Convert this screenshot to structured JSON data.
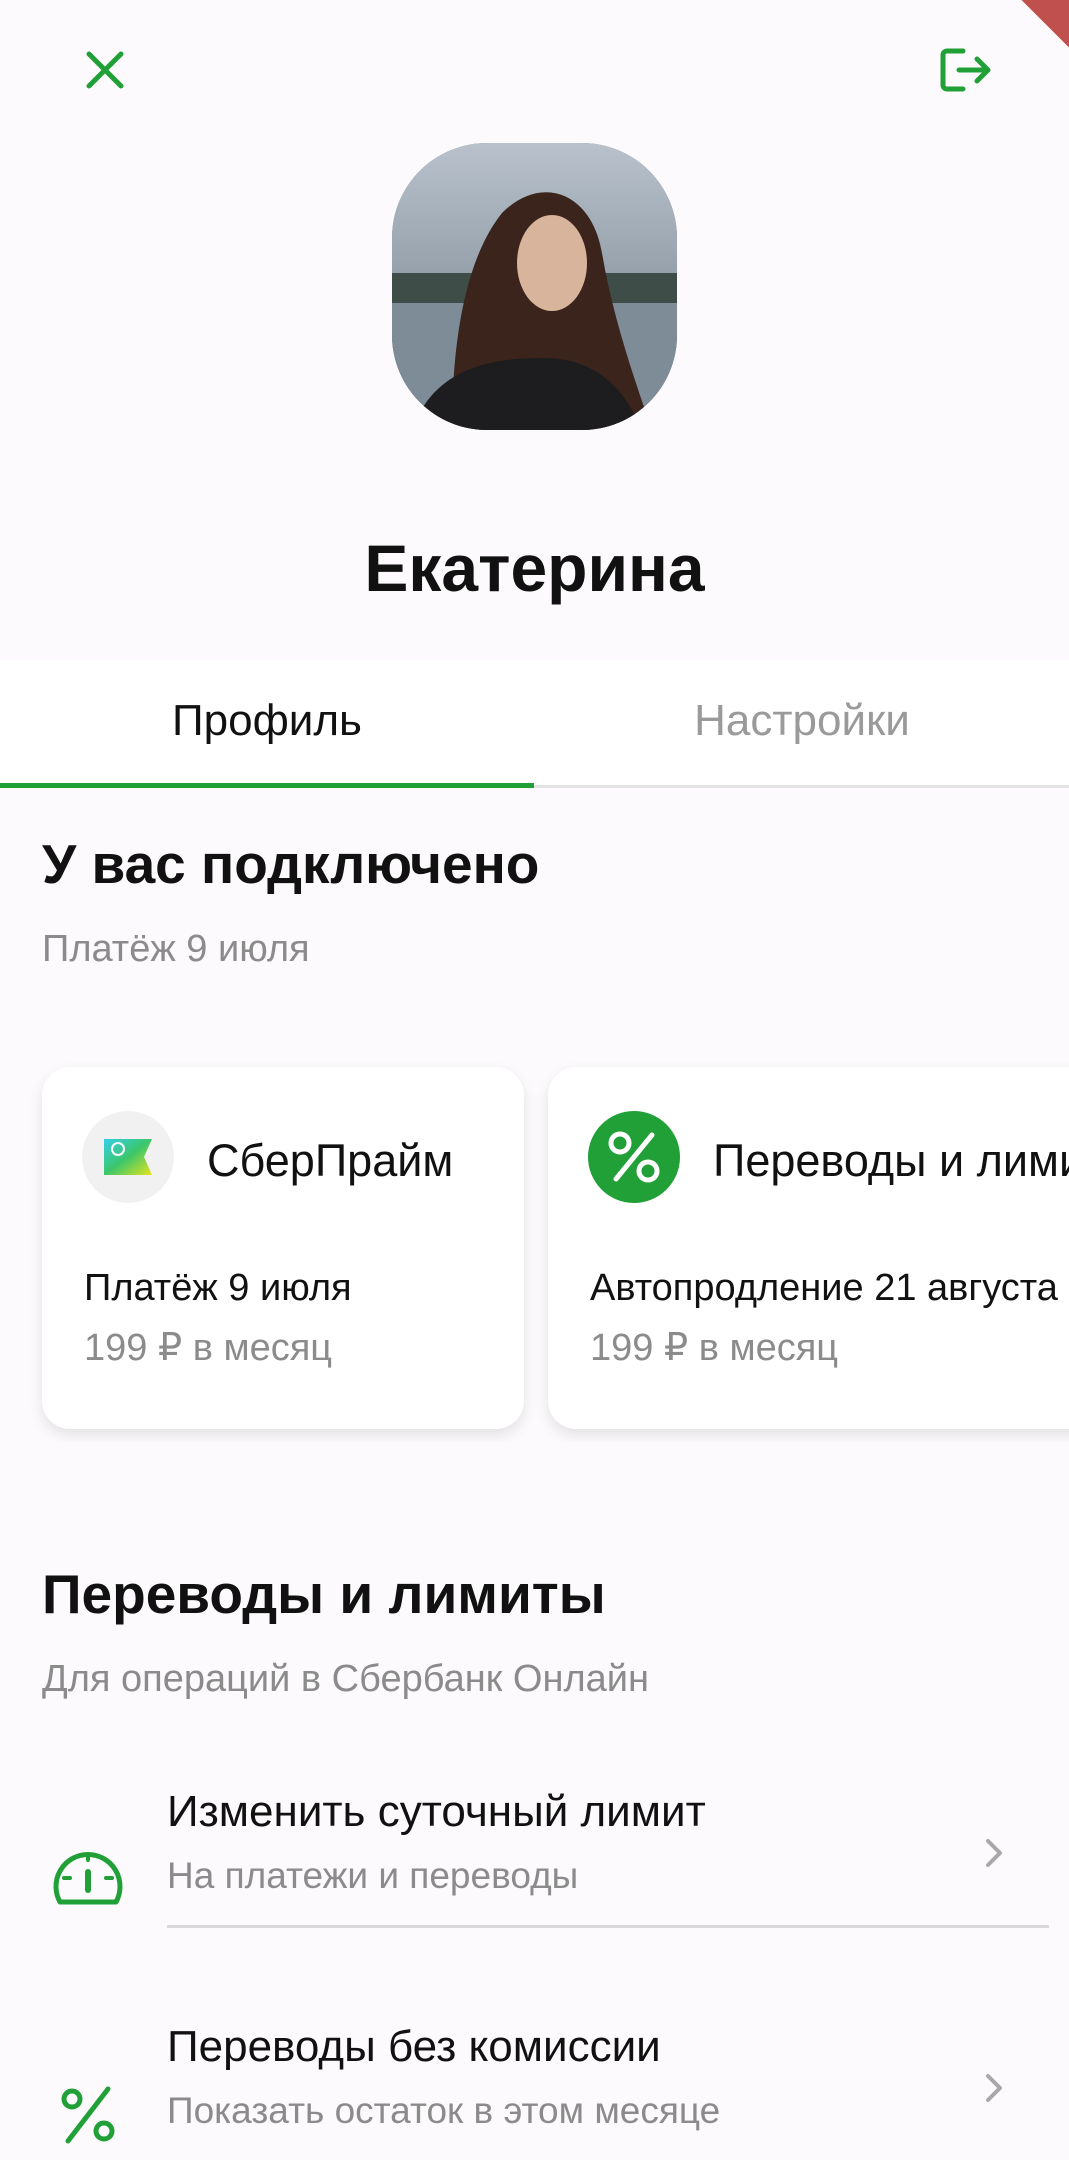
{
  "header": {
    "close_icon": "close-icon",
    "logout_icon": "logout-icon",
    "accent_color": "#21a038"
  },
  "profile": {
    "name": "Екатерина"
  },
  "tabs": [
    {
      "label": "Профиль",
      "active": true
    },
    {
      "label": "Настройки",
      "active": false
    }
  ],
  "subscriptions": {
    "title": "У вас подключено",
    "subtitle": "Платёж 9 июля",
    "cards": [
      {
        "icon": "sberprime-icon",
        "title": "СберПрайм",
        "line1": "Платёж 9 июля",
        "line2": "199 ₽ в месяц"
      },
      {
        "icon": "percent-icon",
        "title": "Переводы и лимиты",
        "line1": "Автопродление 21 августа",
        "line2": "199 ₽ в месяц"
      }
    ]
  },
  "limits": {
    "title": "Переводы и лимиты",
    "subtitle": "Для операций в Сбербанк Онлайн",
    "items": [
      {
        "icon": "speedometer-icon",
        "title": "Изменить суточный лимит",
        "subtitle": "На платежи и переводы"
      },
      {
        "icon": "percent-icon",
        "title": "Переводы без комиссии",
        "subtitle": "Показать остаток в этом месяце"
      }
    ]
  }
}
